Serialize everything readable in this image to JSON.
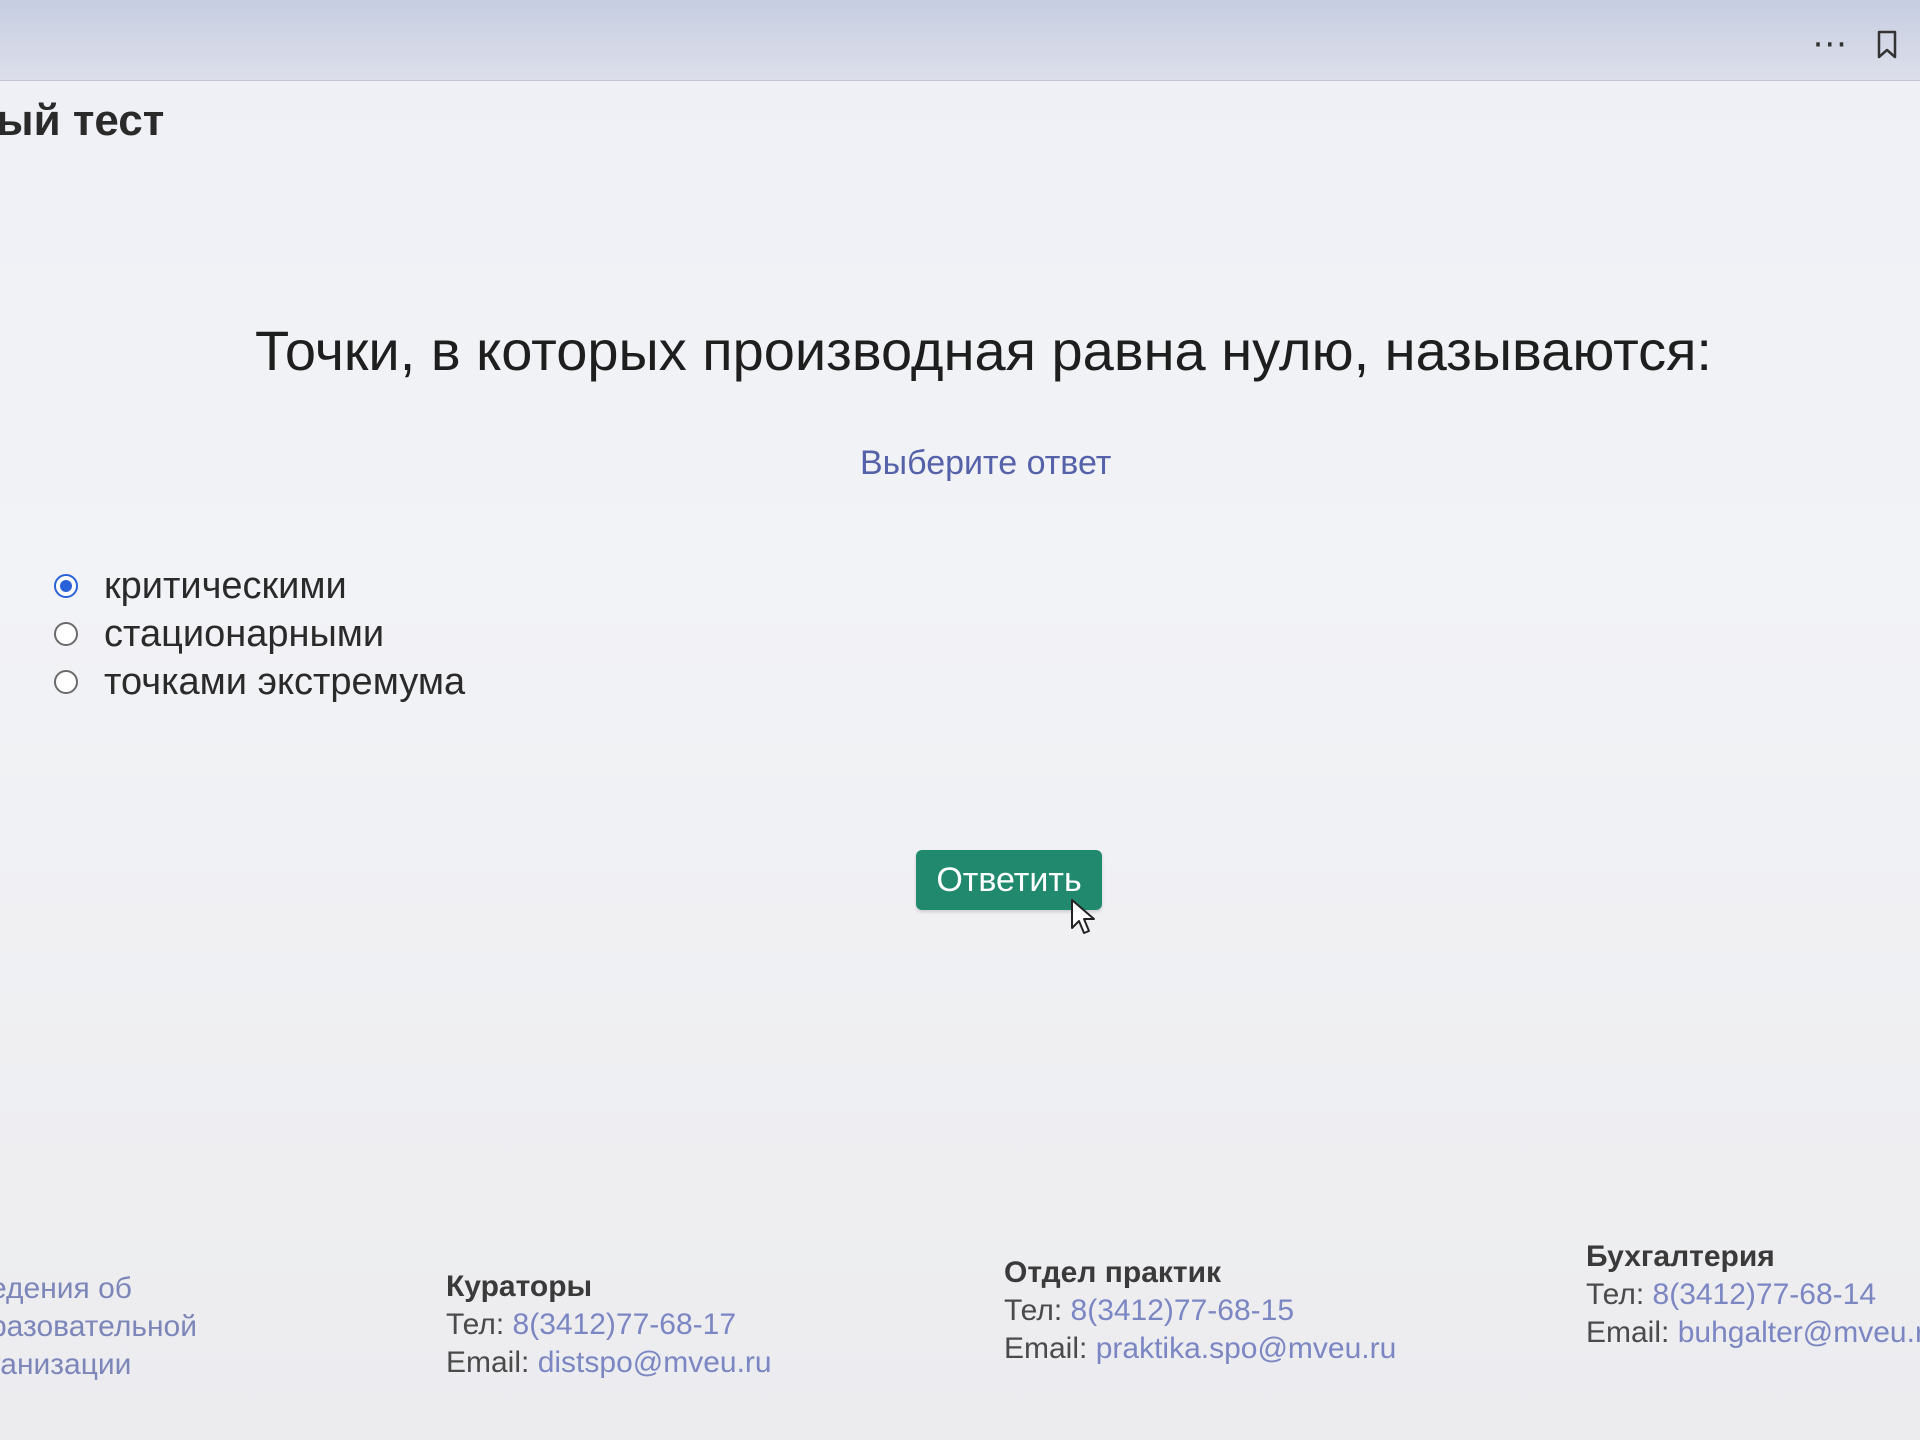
{
  "header": {
    "title": "ый тест"
  },
  "question": {
    "text": "Точки, в которых производная равна нулю, называются:",
    "hint": "Выберите ответ"
  },
  "options": [
    {
      "label": "критическими",
      "checked": true
    },
    {
      "label": "стационарными",
      "checked": false
    },
    {
      "label": "точками экстремума",
      "checked": false
    }
  ],
  "submit": {
    "label": "Ответить",
    "color": "#218a6e"
  },
  "footer": {
    "info": {
      "line1": "едения об",
      "line2": "разовательной",
      "line3": "ганизации"
    },
    "curators": {
      "title": "Кураторы",
      "phone_label": "Тел:",
      "phone": "8(3412)77-68-17",
      "email_label": "Email:",
      "email": "distspo@mveu.ru"
    },
    "practice": {
      "title": "Отдел практик",
      "phone_label": "Тел:",
      "phone": "8(3412)77-68-15",
      "email_label": "Email:",
      "email": "praktika.spo@mveu.ru"
    },
    "accounting": {
      "title": "Бухгалтерия",
      "phone_label": "Тел:",
      "phone": "8(3412)77-68-14",
      "email_label": "Email:",
      "email": "buhgalter@mveu.ru"
    }
  },
  "icons": {
    "menu": "more-dots-icon",
    "bookmark": "bookmark-icon",
    "cursor": "mouse-pointer-icon"
  },
  "colors": {
    "accent_blue": "#2962d8",
    "hint": "#5561a8",
    "link": "#7b86c2"
  }
}
